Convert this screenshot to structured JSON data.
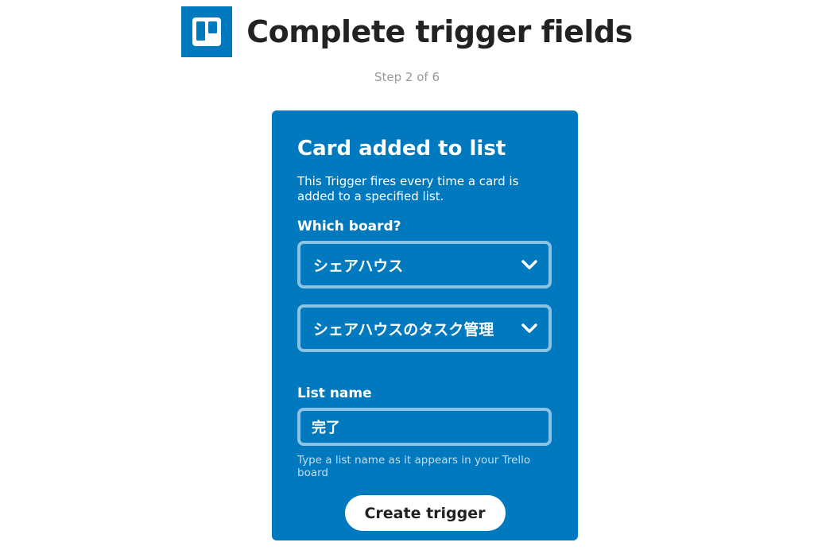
{
  "header": {
    "icon": "trello-logo-icon",
    "title": "Complete trigger fields",
    "step": "Step 2 of 6"
  },
  "card": {
    "title": "Card added to list",
    "description": "This Trigger fires every time a card is added to a specified list.",
    "board_label": "Which board?",
    "board_value": "シェアハウス",
    "list_value": "シェアハウスのタスク管理",
    "list_name_label": "List name",
    "list_name_value": "完了",
    "list_name_hint": "Type a list name as it appears in your Trello board",
    "create_button": "Create trigger"
  },
  "colors": {
    "brand": "#0079bf",
    "title_text": "#222222",
    "muted_text": "#999999"
  }
}
